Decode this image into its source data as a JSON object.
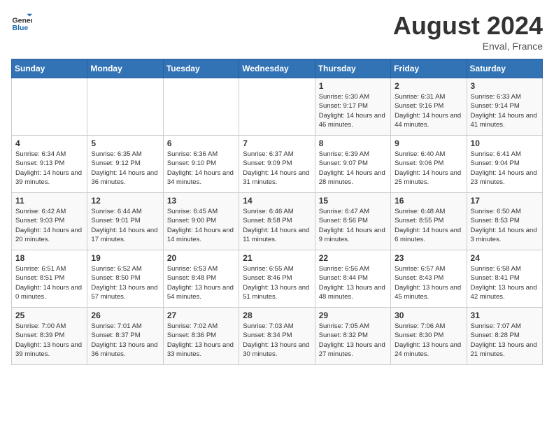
{
  "header": {
    "logo_general": "General",
    "logo_blue": "Blue",
    "month_year": "August 2024",
    "location": "Enval, France"
  },
  "days_of_week": [
    "Sunday",
    "Monday",
    "Tuesday",
    "Wednesday",
    "Thursday",
    "Friday",
    "Saturday"
  ],
  "weeks": [
    [
      {
        "day": "",
        "content": ""
      },
      {
        "day": "",
        "content": ""
      },
      {
        "day": "",
        "content": ""
      },
      {
        "day": "",
        "content": ""
      },
      {
        "day": "1",
        "content": "Sunrise: 6:30 AM\nSunset: 9:17 PM\nDaylight: 14 hours and 46 minutes."
      },
      {
        "day": "2",
        "content": "Sunrise: 6:31 AM\nSunset: 9:16 PM\nDaylight: 14 hours and 44 minutes."
      },
      {
        "day": "3",
        "content": "Sunrise: 6:33 AM\nSunset: 9:14 PM\nDaylight: 14 hours and 41 minutes."
      }
    ],
    [
      {
        "day": "4",
        "content": "Sunrise: 6:34 AM\nSunset: 9:13 PM\nDaylight: 14 hours and 39 minutes."
      },
      {
        "day": "5",
        "content": "Sunrise: 6:35 AM\nSunset: 9:12 PM\nDaylight: 14 hours and 36 minutes."
      },
      {
        "day": "6",
        "content": "Sunrise: 6:36 AM\nSunset: 9:10 PM\nDaylight: 14 hours and 34 minutes."
      },
      {
        "day": "7",
        "content": "Sunrise: 6:37 AM\nSunset: 9:09 PM\nDaylight: 14 hours and 31 minutes."
      },
      {
        "day": "8",
        "content": "Sunrise: 6:39 AM\nSunset: 9:07 PM\nDaylight: 14 hours and 28 minutes."
      },
      {
        "day": "9",
        "content": "Sunrise: 6:40 AM\nSunset: 9:06 PM\nDaylight: 14 hours and 25 minutes."
      },
      {
        "day": "10",
        "content": "Sunrise: 6:41 AM\nSunset: 9:04 PM\nDaylight: 14 hours and 23 minutes."
      }
    ],
    [
      {
        "day": "11",
        "content": "Sunrise: 6:42 AM\nSunset: 9:03 PM\nDaylight: 14 hours and 20 minutes."
      },
      {
        "day": "12",
        "content": "Sunrise: 6:44 AM\nSunset: 9:01 PM\nDaylight: 14 hours and 17 minutes."
      },
      {
        "day": "13",
        "content": "Sunrise: 6:45 AM\nSunset: 9:00 PM\nDaylight: 14 hours and 14 minutes."
      },
      {
        "day": "14",
        "content": "Sunrise: 6:46 AM\nSunset: 8:58 PM\nDaylight: 14 hours and 11 minutes."
      },
      {
        "day": "15",
        "content": "Sunrise: 6:47 AM\nSunset: 8:56 PM\nDaylight: 14 hours and 9 minutes."
      },
      {
        "day": "16",
        "content": "Sunrise: 6:48 AM\nSunset: 8:55 PM\nDaylight: 14 hours and 6 minutes."
      },
      {
        "day": "17",
        "content": "Sunrise: 6:50 AM\nSunset: 8:53 PM\nDaylight: 14 hours and 3 minutes."
      }
    ],
    [
      {
        "day": "18",
        "content": "Sunrise: 6:51 AM\nSunset: 8:51 PM\nDaylight: 14 hours and 0 minutes."
      },
      {
        "day": "19",
        "content": "Sunrise: 6:52 AM\nSunset: 8:50 PM\nDaylight: 13 hours and 57 minutes."
      },
      {
        "day": "20",
        "content": "Sunrise: 6:53 AM\nSunset: 8:48 PM\nDaylight: 13 hours and 54 minutes."
      },
      {
        "day": "21",
        "content": "Sunrise: 6:55 AM\nSunset: 8:46 PM\nDaylight: 13 hours and 51 minutes."
      },
      {
        "day": "22",
        "content": "Sunrise: 6:56 AM\nSunset: 8:44 PM\nDaylight: 13 hours and 48 minutes."
      },
      {
        "day": "23",
        "content": "Sunrise: 6:57 AM\nSunset: 8:43 PM\nDaylight: 13 hours and 45 minutes."
      },
      {
        "day": "24",
        "content": "Sunrise: 6:58 AM\nSunset: 8:41 PM\nDaylight: 13 hours and 42 minutes."
      }
    ],
    [
      {
        "day": "25",
        "content": "Sunrise: 7:00 AM\nSunset: 8:39 PM\nDaylight: 13 hours and 39 minutes."
      },
      {
        "day": "26",
        "content": "Sunrise: 7:01 AM\nSunset: 8:37 PM\nDaylight: 13 hours and 36 minutes."
      },
      {
        "day": "27",
        "content": "Sunrise: 7:02 AM\nSunset: 8:36 PM\nDaylight: 13 hours and 33 minutes."
      },
      {
        "day": "28",
        "content": "Sunrise: 7:03 AM\nSunset: 8:34 PM\nDaylight: 13 hours and 30 minutes."
      },
      {
        "day": "29",
        "content": "Sunrise: 7:05 AM\nSunset: 8:32 PM\nDaylight: 13 hours and 27 minutes."
      },
      {
        "day": "30",
        "content": "Sunrise: 7:06 AM\nSunset: 8:30 PM\nDaylight: 13 hours and 24 minutes."
      },
      {
        "day": "31",
        "content": "Sunrise: 7:07 AM\nSunset: 8:28 PM\nDaylight: 13 hours and 21 minutes."
      }
    ]
  ]
}
